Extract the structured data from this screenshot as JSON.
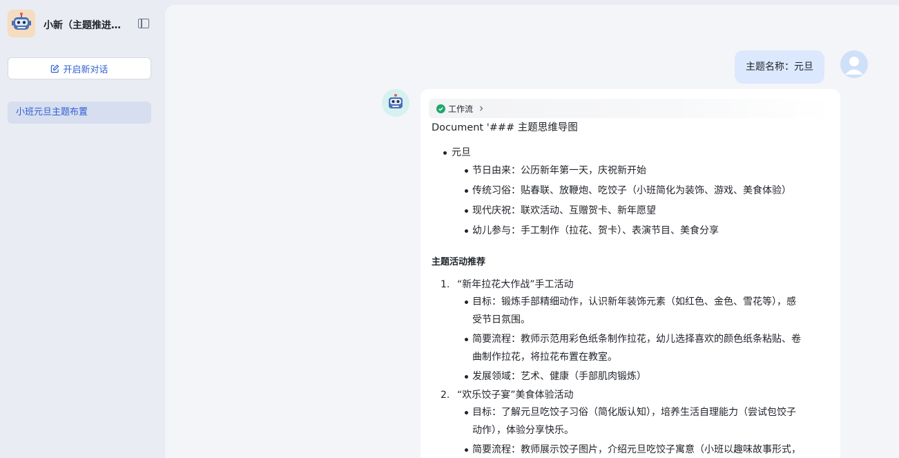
{
  "sidebar": {
    "app_title": "小新（主题推进…",
    "new_chat_label": "开启新对话",
    "history": [
      {
        "label": "小班元旦主题布置"
      }
    ]
  },
  "chat": {
    "user_message": "主题名称：元旦",
    "workflow_label": "工作流",
    "doc_title": "Document '### 主题思维导图",
    "mindmap_root": "元旦",
    "mindmap_items": [
      "节日由来：公历新年第一天，庆祝新开始",
      "传统习俗：贴春联、放鞭炮、吃饺子（小班简化为装饰、游戏、美食体验）",
      "现代庆祝：联欢活动、互赠贺卡、新年愿望",
      "幼儿参与：手工制作（拉花、贺卡）、表演节目、美食分享"
    ],
    "section_heading": "主题活动推荐",
    "activities": [
      {
        "num": "1.",
        "title": "“新年拉花大作战”手工活动",
        "points": [
          [
            "目标：锻炼手部精细动作，认识新年装饰元素（如红色、金色、雪花等），感",
            "受节日氛围。"
          ],
          [
            "简要流程：教师示范用彩色纸条制作拉花，幼儿选择喜欢的颜色纸条粘贴、卷",
            "曲制作拉花，将拉花布置在教室。"
          ],
          [
            "发展领域：艺术、健康（手部肌肉锻炼）"
          ]
        ]
      },
      {
        "num": "2.",
        "title": "“欢乐饺子宴”美食体验活动",
        "points": [
          [
            "目标：了解元旦吃饺子习俗（简化版认知），培养生活自理能力（尝试包饺子",
            "动作），体验分享快乐。"
          ],
          [
            "简要流程：教师展示饺子图片，介绍元旦吃饺子寓意（小班以趣味故事形式，"
          ]
        ]
      }
    ]
  },
  "colors": {
    "accent": "#2f5fd0",
    "user_bubble": "#dbe8fe",
    "success": "#1fa86a"
  }
}
